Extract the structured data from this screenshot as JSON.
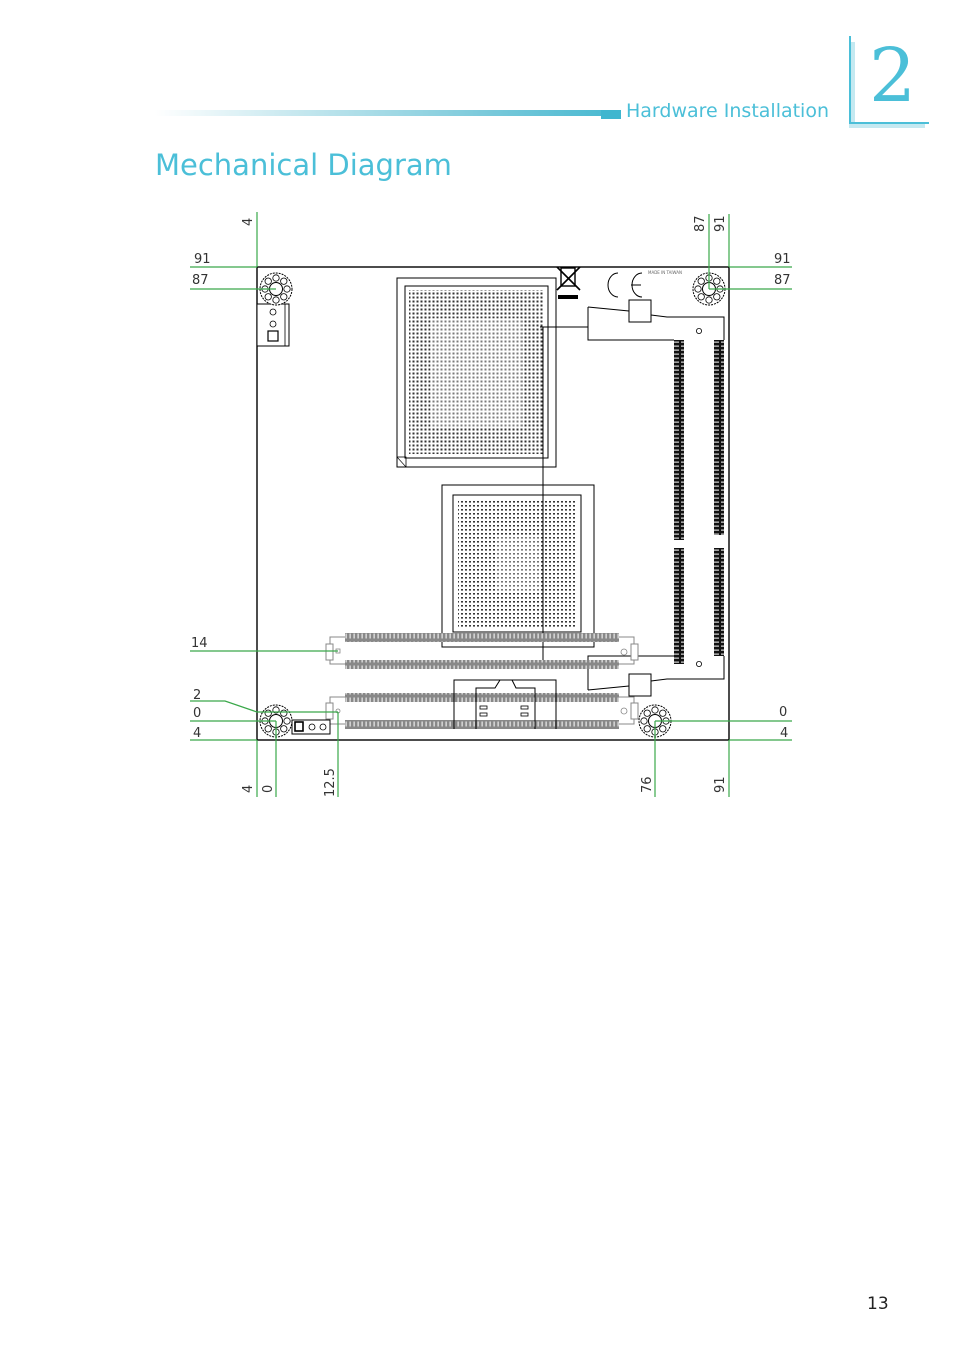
{
  "header": {
    "section": "Hardware Installation",
    "chapter_number": "2"
  },
  "page_title": "Mechanical Diagram",
  "page_number": "13",
  "diagram": {
    "board_marking": "MADE IN TAIWAN",
    "dimension_labels": {
      "top": [
        "4",
        "87",
        "91"
      ],
      "left": [
        "91",
        "87",
        "14",
        "2",
        "0",
        "4"
      ],
      "right": [
        "91",
        "87",
        "0",
        "4"
      ],
      "bottom": [
        "4",
        "0",
        "12.5",
        "76",
        "91"
      ]
    },
    "colors": {
      "accent": "#4bbfd8",
      "dimension_line": "#3aa84a",
      "outline": "#000000",
      "slot_gray": "#888888"
    }
  }
}
